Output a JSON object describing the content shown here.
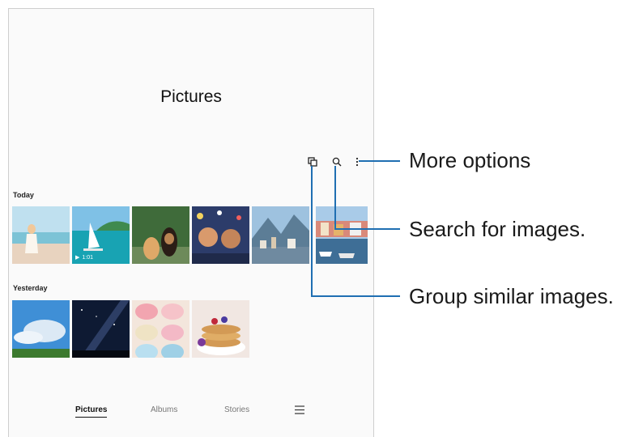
{
  "header": {
    "title": "Pictures"
  },
  "toolbar": {
    "group_icon": "group-similar-icon",
    "search_icon": "search-icon",
    "more_icon": "more-options-icon"
  },
  "sections": [
    {
      "label": "Today"
    },
    {
      "label": "Yesterday"
    }
  ],
  "video": {
    "duration": "1:01"
  },
  "bottom_nav": {
    "items": [
      "Pictures",
      "Albums",
      "Stories"
    ],
    "active": "Pictures",
    "menu_icon": "menu-icon"
  },
  "callouts": {
    "more_options": "More options",
    "search": "Search for images.",
    "group": "Group similar images."
  },
  "colors": {
    "leader_line": "#1f6fb2",
    "accent": "#111111"
  }
}
